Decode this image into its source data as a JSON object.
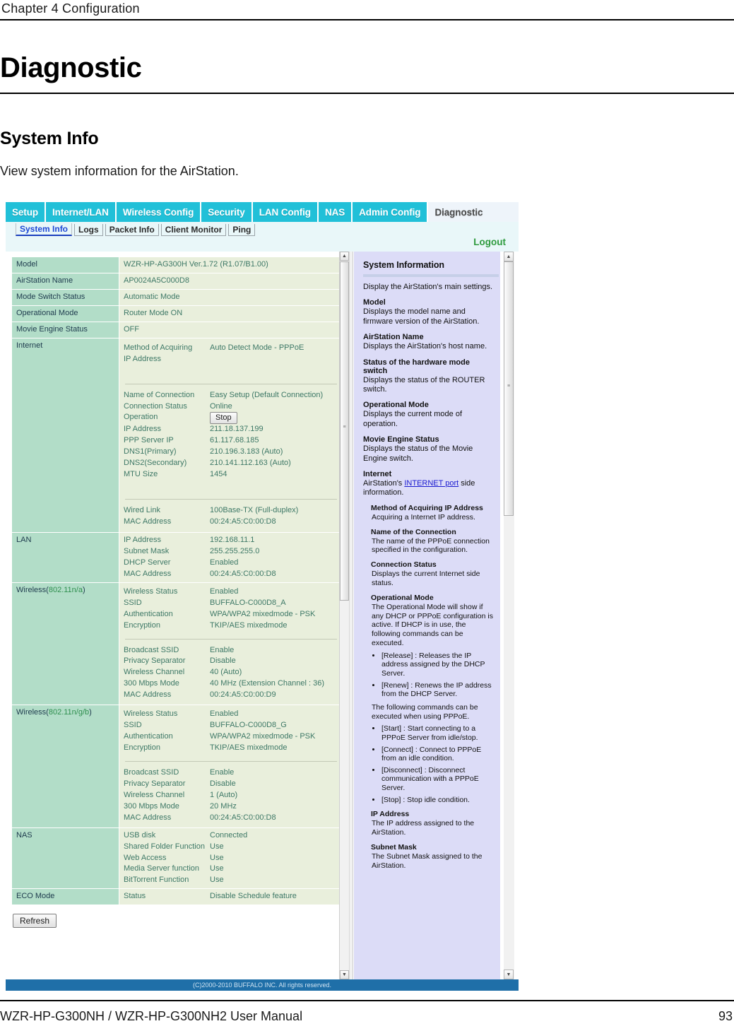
{
  "document": {
    "chapter": "Chapter 4  Configuration",
    "h1": "Diagnostic",
    "h2": "System Info",
    "intro": "View system information for the AirStation.",
    "footer_left": "WZR-HP-G300NH / WZR-HP-G300NH2 User Manual",
    "footer_page": "93"
  },
  "router_ui": {
    "tabs": [
      {
        "label": "Setup",
        "active": false
      },
      {
        "label": "Internet/LAN",
        "active": false
      },
      {
        "label": "Wireless Config",
        "active": false
      },
      {
        "label": "Security",
        "active": false
      },
      {
        "label": "LAN Config",
        "active": false
      },
      {
        "label": "NAS",
        "active": false
      },
      {
        "label": "Admin Config",
        "active": false
      },
      {
        "label": "Diagnostic",
        "active": true
      }
    ],
    "subtabs": [
      {
        "label": "System Info",
        "active": true
      },
      {
        "label": "Logs",
        "active": false
      },
      {
        "label": "Packet Info",
        "active": false
      },
      {
        "label": "Client Monitor",
        "active": false
      },
      {
        "label": "Ping",
        "active": false
      }
    ],
    "logout_label": "Logout",
    "refresh_label": "Refresh",
    "stop_label": "Stop",
    "copyright": "(C)2000-2010 BUFFALO INC. All rights reserved.",
    "colors": {
      "tab_active_bg": "#eef4fa",
      "tab_bg": "#21c0d8",
      "label_cell_bg": "#b2ddc8",
      "value_cell_bg": "#e9efdc",
      "help_bg": "#dcdcf7",
      "copybar_bg": "#1f6fa8",
      "logout_green": "#2e9b3e"
    },
    "table": {
      "simple_rows": [
        {
          "label": "Model",
          "value": "WZR-HP-AG300H Ver.1.72 (R1.07/B1.00)"
        },
        {
          "label": "AirStation Name",
          "value": "AP0024A5C000D8"
        },
        {
          "label": "Mode Switch Status",
          "value": "Automatic Mode"
        },
        {
          "label": "Operational Mode",
          "value": "Router Mode ON"
        },
        {
          "label": "Movie Engine Status",
          "value": "OFF"
        }
      ],
      "internet": {
        "label": "Internet",
        "group1": [
          {
            "k": "Method of Acquiring IP Address",
            "v": "Auto Detect Mode - PPPoE"
          }
        ],
        "group2": [
          {
            "k": "Name of Connection",
            "v": "Easy Setup (Default Connection)"
          },
          {
            "k": "Connection Status",
            "v": "Online"
          },
          {
            "k": "Operation",
            "v": "Stop",
            "is_button": true
          },
          {
            "k": "IP Address",
            "v": "211.18.137.199"
          },
          {
            "k": "PPP Server IP",
            "v": "61.117.68.185"
          },
          {
            "k": "DNS1(Primary)",
            "v": "210.196.3.183 (Auto)"
          },
          {
            "k": "DNS2(Secondary)",
            "v": "210.141.112.163 (Auto)"
          },
          {
            "k": "MTU Size",
            "v": "1454"
          }
        ],
        "group3": [
          {
            "k": "Wired Link",
            "v": "100Base-TX (Full-duplex)"
          },
          {
            "k": "MAC Address",
            "v": "00:24:A5:C0:00:D8"
          }
        ]
      },
      "lan": {
        "label": "LAN",
        "rows": [
          {
            "k": "IP Address",
            "v": "192.168.11.1"
          },
          {
            "k": "Subnet Mask",
            "v": "255.255.255.0"
          },
          {
            "k": "DHCP Server",
            "v": "Enabled"
          },
          {
            "k": "MAC Address",
            "v": "00:24:A5:C0:00:D8"
          }
        ]
      },
      "wireless_a": {
        "label_prefix": "Wireless(",
        "label_accent": "802.11n/a",
        "label_suffix": ")",
        "group1": [
          {
            "k": "Wireless Status",
            "v": "Enabled"
          },
          {
            "k": "SSID",
            "v": "BUFFALO-C000D8_A"
          },
          {
            "k": "Authentication",
            "v": "WPA/WPA2 mixedmode - PSK"
          },
          {
            "k": "Encryption",
            "v": "TKIP/AES mixedmode"
          }
        ],
        "group2": [
          {
            "k": "Broadcast SSID",
            "v": "Enable"
          },
          {
            "k": "Privacy Separator",
            "v": "Disable"
          },
          {
            "k": "Wireless Channel",
            "v": "40 (Auto)"
          },
          {
            "k": "300 Mbps Mode",
            "v": "40 MHz (Extension Channel : 36)"
          },
          {
            "k": "MAC Address",
            "v": "00:24:A5:C0:00:D9"
          }
        ]
      },
      "wireless_g": {
        "label_prefix": "Wireless(",
        "label_accent": "802.11n/g/b",
        "label_suffix": ")",
        "group1": [
          {
            "k": "Wireless Status",
            "v": "Enabled"
          },
          {
            "k": "SSID",
            "v": "BUFFALO-C000D8_G"
          },
          {
            "k": "Authentication",
            "v": "WPA/WPA2 mixedmode - PSK"
          },
          {
            "k": "Encryption",
            "v": "TKIP/AES mixedmode"
          }
        ],
        "group2": [
          {
            "k": "Broadcast SSID",
            "v": "Enable"
          },
          {
            "k": "Privacy Separator",
            "v": "Disable"
          },
          {
            "k": "Wireless Channel",
            "v": "1 (Auto)"
          },
          {
            "k": "300 Mbps Mode",
            "v": "20 MHz"
          },
          {
            "k": "MAC Address",
            "v": "00:24:A5:C0:00:D8"
          }
        ]
      },
      "nas": {
        "label": "NAS",
        "rows": [
          {
            "k": "USB disk",
            "v": "Connected"
          },
          {
            "k": "Shared Folder Function",
            "v": "Use"
          },
          {
            "k": "Web Access",
            "v": "Use"
          },
          {
            "k": "Media Server function",
            "v": "Use"
          },
          {
            "k": "BitTorrent Function",
            "v": "Use"
          }
        ]
      },
      "eco": {
        "label": "ECO Mode",
        "rows": [
          {
            "k": "Status",
            "v": "Disable Schedule feature"
          }
        ]
      }
    },
    "help": {
      "title": "System Information",
      "intro": "Display the AirStation's main settings.",
      "sections": [
        {
          "h": "Model",
          "p": "Displays the model name and firmware version of the AirStation."
        },
        {
          "h": "AirStation Name",
          "p": "Displays the AirStation's host name."
        },
        {
          "h": "Status of the hardware mode switch",
          "p": "Displays the status of the ROUTER switch."
        },
        {
          "h": "Operational Mode",
          "p": "Displays the current mode of operation."
        },
        {
          "h": "Movie Engine Status",
          "p": "Displays the status of the Movie Engine switch."
        }
      ],
      "internet_h": "Internet",
      "internet_p_pre": "AirStation's ",
      "internet_link": "INTERNET port",
      "internet_p_post": " side information.",
      "sub_sections": [
        {
          "h": "Method of Acquiring IP Address",
          "p": "Acquiring a Internet IP address."
        },
        {
          "h": "Name of the Connection",
          "p": "The name of the PPPoE connection specified in the configuration."
        },
        {
          "h": "Connection Status",
          "p": "Displays the current Internet side status."
        }
      ],
      "op_mode_h": "Operational Mode",
      "op_mode_p": "The Operational Mode will show if any DHCP or PPPoE configuration is active. If DHCP is in use, the following commands can be executed.",
      "dhcp_bullets": [
        "[Release] : Releases the IP address assigned by the DHCP Server.",
        "[Renew] : Renews the IP address from the DHCP Server."
      ],
      "pppoe_intro": "The following commands can be executed when using PPPoE.",
      "pppoe_bullets": [
        "[Start] : Start connecting to a PPPoE Server from idle/stop.",
        "[Connect] : Connect to PPPoE from an idle condition.",
        "[Disconnect] : Disconnect communication with a PPPoE Server.",
        "[Stop] : Stop idle condition."
      ],
      "tail_sections": [
        {
          "h": "IP Address",
          "p": "The IP address assigned to the AirStation."
        },
        {
          "h": "Subnet Mask",
          "p": "The Subnet Mask assigned to the AirStation."
        }
      ]
    }
  }
}
